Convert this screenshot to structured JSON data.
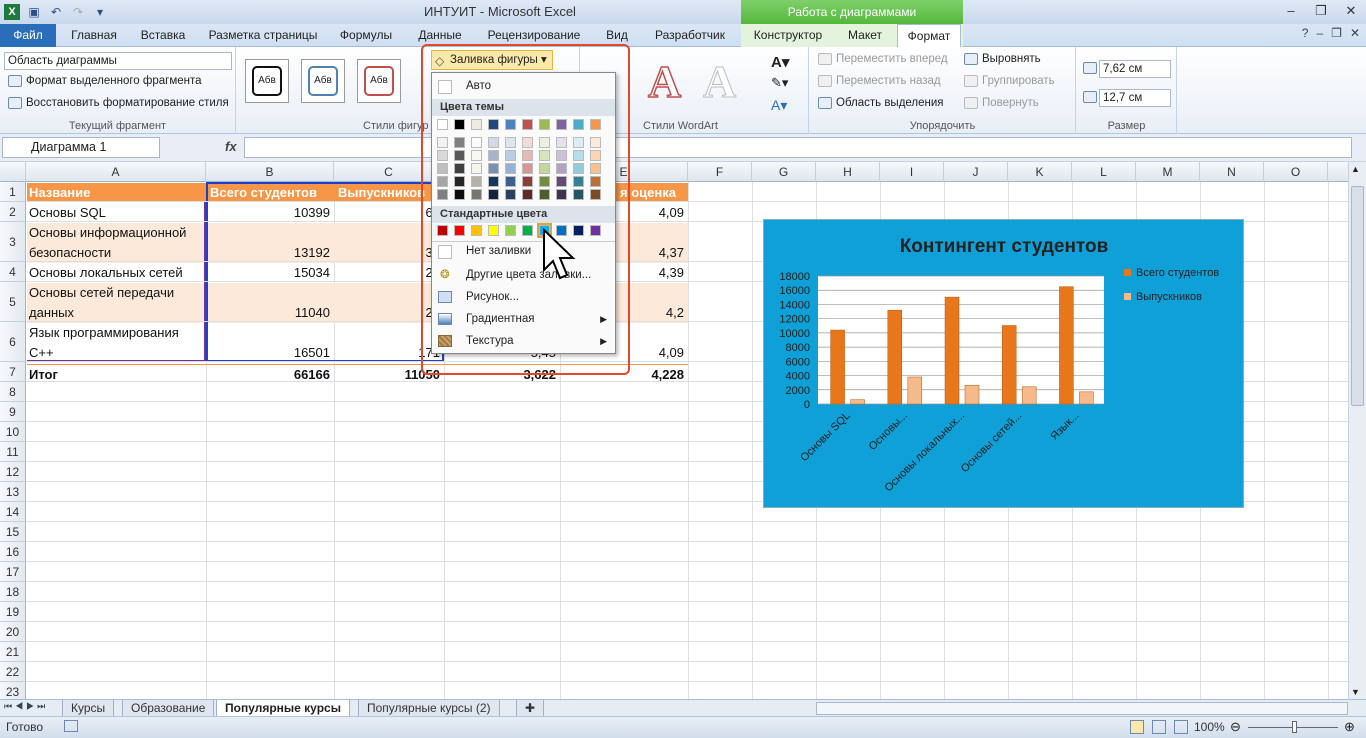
{
  "window": {
    "title": "ИНТУИТ - Microsoft Excel",
    "context_header": "Работа с диаграммами"
  },
  "tabs": {
    "file": "Файл",
    "items": [
      "Главная",
      "Вставка",
      "Разметка страницы",
      "Формулы",
      "Данные",
      "Рецензирование",
      "Вид",
      "Разработчик"
    ],
    "ctx": [
      "Конструктор",
      "Макет",
      "Формат"
    ]
  },
  "ribbon": {
    "current": {
      "selector": "Область диаграммы",
      "format_sel": "Формат выделенного фрагмента",
      "restore": "Восстановить форматирование стиля",
      "label": "Текущий фрагмент"
    },
    "shape_styles": {
      "sample": "Абв",
      "label": "Стили фигур"
    },
    "fill_button": "Заливка фигуры",
    "wordart": {
      "label": "Стили WordArt",
      "glyph": "A"
    },
    "arrange": {
      "forward": "Переместить вперед",
      "back": "Переместить назад",
      "selpane": "Область выделения",
      "align": "Выровнять",
      "group": "Группировать",
      "rotate": "Повернуть",
      "label": "Упорядочить"
    },
    "size": {
      "height": "7,62 см",
      "width": "12,7 см",
      "label": "Размер"
    }
  },
  "formula": {
    "namebox": "Диаграмма 1",
    "fx": "fx"
  },
  "columns": [
    "A",
    "B",
    "C",
    "D",
    "E",
    "F",
    "G",
    "H",
    "I",
    "J",
    "K",
    "L",
    "M",
    "N",
    "O"
  ],
  "rows": [
    "1",
    "2",
    "3",
    "4",
    "5",
    "6",
    "7",
    "8",
    "9",
    "10",
    "11",
    "12",
    "13",
    "14",
    "15",
    "16",
    "17",
    "18",
    "19",
    "20",
    "21",
    "22",
    "23"
  ],
  "table": {
    "header": {
      "a": "Название",
      "b": "Всего студентов",
      "c": "Выпускников",
      "e": "я оценка"
    },
    "r2": {
      "a": "Основы SQL",
      "b": "10399",
      "c": "61",
      "e": "4,09"
    },
    "r3": {
      "a1": "Основы информационной",
      "a2": "безопасности",
      "b": "13192",
      "c": "33",
      "e": "4,37"
    },
    "r4": {
      "a": "Основы локальных сетей",
      "b": "15034",
      "c": "26",
      "e": "4,39"
    },
    "r5": {
      "a1": "Основы сетей передачи",
      "a2": "данных",
      "b": "11040",
      "c": "24",
      "e": "4,2"
    },
    "r6": {
      "a1": "Язык программирования",
      "a2": "С++",
      "b": "16501",
      "c": "171",
      "d": "5,45",
      "e": "4,09"
    },
    "r7": {
      "a": "Итог",
      "b": "66166",
      "c": "11050",
      "d": "3,622",
      "e": "4,228"
    }
  },
  "menu": {
    "auto": "Авто",
    "theme": "Цвета темы",
    "standard": "Стандартные цвета",
    "nofill": "Нет заливки",
    "more": "Другие цвета заливки...",
    "picture": "Рисунок...",
    "gradient": "Градиентная",
    "texture": "Текстура",
    "theme_top": [
      "#ffffff",
      "#000000",
      "#eeece1",
      "#1f497d",
      "#4f81bd",
      "#c0504d",
      "#9bbb59",
      "#8064a2",
      "#4bacc6",
      "#f79646"
    ],
    "std": [
      "#c00000",
      "#ff0000",
      "#ffc000",
      "#ffff00",
      "#92d050",
      "#00b050",
      "#00b0f0",
      "#0070c0",
      "#002060",
      "#7030a0"
    ]
  },
  "chart_data": {
    "type": "bar",
    "title": "Контингент студентов",
    "categories": [
      "Основы SQL",
      "Основы...",
      "Основы локальных...",
      "Основы сетей...",
      "Язык..."
    ],
    "series": [
      {
        "name": "Всего студентов",
        "values": [
          10399,
          13192,
          15034,
          11040,
          16501
        ],
        "color": "#e8761b"
      },
      {
        "name": "Выпускников",
        "values": [
          610,
          3800,
          2640,
          2420,
          1710
        ],
        "color": "#f6b98a"
      }
    ],
    "yticks": [
      "18000",
      "16000",
      "14000",
      "12000",
      "10000",
      "8000",
      "6000",
      "4000",
      "2000",
      "0"
    ],
    "ylim": [
      0,
      18000
    ],
    "grid": true,
    "legend": "right"
  },
  "sheet_tabs": [
    "Курсы",
    "Образование",
    "Популярные курсы",
    "Популярные курсы (2)"
  ],
  "status": {
    "ready": "Готово",
    "zoom": "100%"
  }
}
